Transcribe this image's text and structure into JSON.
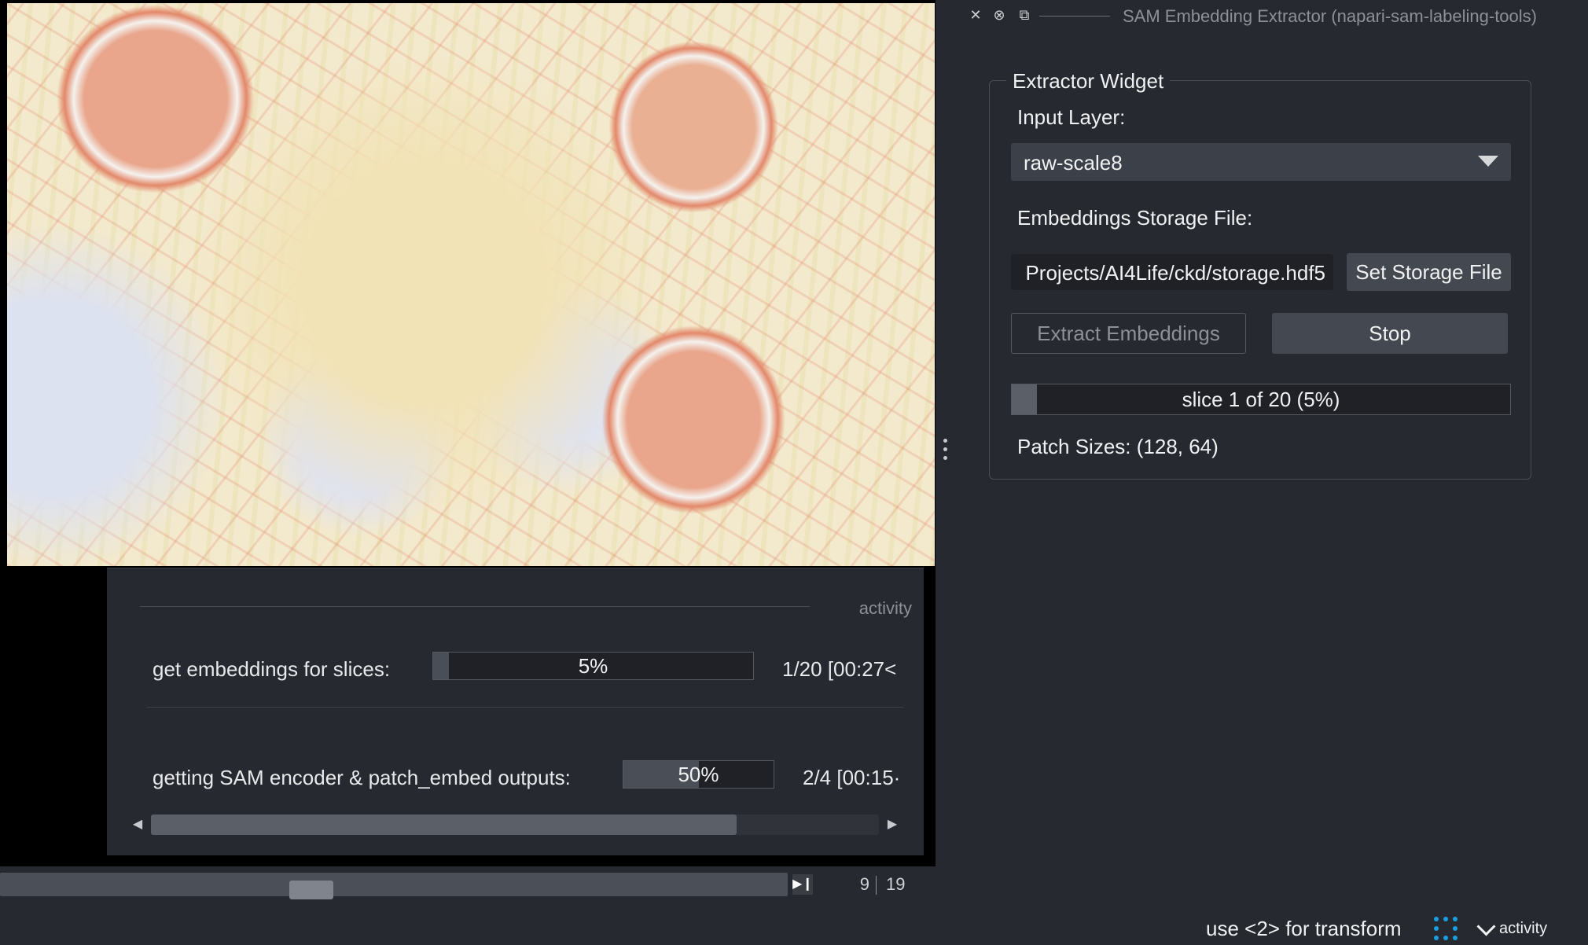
{
  "dock": {
    "title": "SAM Embedding Extractor (napari-sam-labeling-tools)",
    "icons": [
      "close-icon",
      "float-icon",
      "restore-icon"
    ],
    "group_title": "Extractor Widget",
    "input_layer_label": "Input Layer:",
    "input_layer_value": "raw-scale8",
    "storage_label": "Embeddings Storage File:",
    "storage_path": "Projects/AI4Life/ckd/storage.hdf5",
    "set_storage_button": "Set Storage File",
    "extract_button": "Extract Embeddings",
    "stop_button": "Stop",
    "progress": {
      "text": "slice 1 of 20 (5%)",
      "fraction": 0.05
    },
    "patch_sizes": "Patch Sizes: (128, 64)"
  },
  "activity": {
    "title": "activity",
    "tasks": [
      {
        "label": "get embeddings for slices:",
        "bar_text": "5%",
        "fraction": 0.05,
        "detail": "1/20 [00:27<"
      },
      {
        "label": "getting SAM encoder & patch_embed outputs:",
        "bar_text": "50%",
        "fraction": 0.5,
        "detail": "2/4 [00:15·"
      }
    ]
  },
  "dims": {
    "current": "9",
    "total": "19"
  },
  "status": {
    "message": "use <2> for transform",
    "activity_toggle": "activity",
    "indicator_color": "#1a9fe0"
  }
}
